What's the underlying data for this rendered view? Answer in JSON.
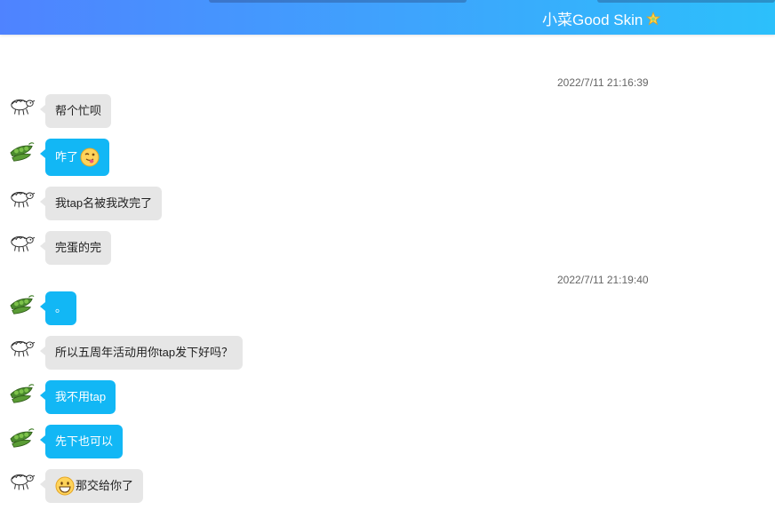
{
  "window": {
    "title": "小菜Good Skin",
    "accent_colors": {
      "header_start": "#4f83ff",
      "header_end": "#2cc0fb",
      "sent_bubble": "#12b7f5",
      "received_bubble": "#e6e6e6"
    },
    "title_icon": "star-icon"
  },
  "chat": {
    "timestamps": [
      "2022/7/11 21:16:39",
      "2022/7/11 21:19:40"
    ],
    "messages": [
      {
        "sender": "other",
        "avatar": "sheep-avatar",
        "text": "帮个忙呗"
      },
      {
        "sender": "self",
        "avatar": "peas-avatar",
        "text": "咋了",
        "emoji_after": "tongue-face-emoji"
      },
      {
        "sender": "other",
        "avatar": "sheep-avatar",
        "text": "我tap名被我改完了"
      },
      {
        "sender": "other",
        "avatar": "sheep-avatar",
        "text": "完蛋的完"
      },
      {
        "sender": "self",
        "avatar": "peas-avatar",
        "text": "。"
      },
      {
        "sender": "other",
        "avatar": "sheep-avatar",
        "text": "所以五周年活动用你tap发下好吗？"
      },
      {
        "sender": "self",
        "avatar": "peas-avatar",
        "text": "我不用tap"
      },
      {
        "sender": "self",
        "avatar": "peas-avatar",
        "text": "先下也可以"
      },
      {
        "sender": "other",
        "avatar": "sheep-avatar",
        "text": "那交给你了",
        "emoji_before": "grin-face-emoji"
      }
    ]
  }
}
